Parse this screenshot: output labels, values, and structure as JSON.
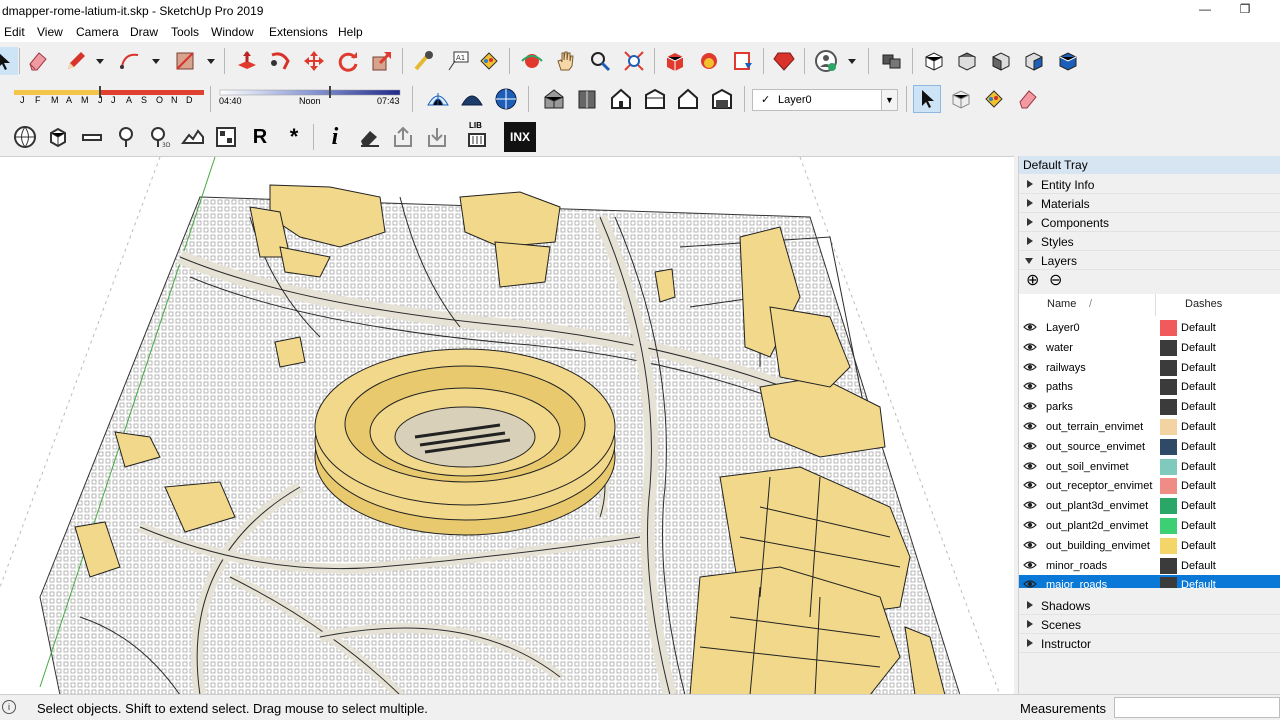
{
  "window": {
    "title": "dmapper-rome-latium-it.skp - SketchUp Pro 2019",
    "minimize_glyph": "—",
    "restore_glyph": "❐"
  },
  "menu": [
    "Edit",
    "View",
    "Camera",
    "Draw",
    "Tools",
    "Window",
    "Extensions",
    "Help"
  ],
  "shadow_settings": {
    "months": [
      "J",
      "F",
      "M",
      "A",
      "M",
      "J",
      "J",
      "A",
      "S",
      "O",
      "N",
      "D"
    ],
    "time_start": "04:40",
    "time_noon": "Noon",
    "time_end": "07:43"
  },
  "layer_selector": {
    "current": "Layer0",
    "check": "✓"
  },
  "toolbar3": {
    "r_label": "R",
    "asterisk_label": "*",
    "info_label": "i",
    "lib_label": "LIB",
    "inx_label": "INX"
  },
  "tray": {
    "title": "Default Tray",
    "panels_top": [
      "Entity Info",
      "Materials",
      "Components",
      "Styles"
    ],
    "layers_panel": "Layers",
    "add_glyph": "⊕",
    "remove_glyph": "⊖",
    "columns": {
      "name": "Name",
      "sort": "/",
      "dashes": "Dashes"
    },
    "layers": [
      {
        "name": "Layer0",
        "color": "#f05a5a",
        "dashes": "Default"
      },
      {
        "name": "water",
        "color": "#3b3b3b",
        "dashes": "Default"
      },
      {
        "name": "railways",
        "color": "#3b3b3b",
        "dashes": "Default"
      },
      {
        "name": "paths",
        "color": "#3b3b3b",
        "dashes": "Default"
      },
      {
        "name": "parks",
        "color": "#3b3b3b",
        "dashes": "Default"
      },
      {
        "name": "out_terrain_envimet",
        "color": "#f4d3a2",
        "dashes": "Default"
      },
      {
        "name": "out_source_envimet",
        "color": "#2f4a66",
        "dashes": "Default"
      },
      {
        "name": "out_soil_envimet",
        "color": "#7fcabd",
        "dashes": "Default"
      },
      {
        "name": "out_receptor_envimet",
        "color": "#f08c86",
        "dashes": "Default"
      },
      {
        "name": "out_plant3d_envimet",
        "color": "#2aa666",
        "dashes": "Default"
      },
      {
        "name": "out_plant2d_envimet",
        "color": "#3ccf73",
        "dashes": "Default"
      },
      {
        "name": "out_building_envimet",
        "color": "#f3d56a",
        "dashes": "Default"
      },
      {
        "name": "minor_roads",
        "color": "#3b3b3b",
        "dashes": "Default"
      },
      {
        "name": "major_roads",
        "color": "#3b3b3b",
        "dashes": "Default"
      }
    ],
    "panels_bottom": [
      "Shadows",
      "Scenes",
      "Instructor"
    ]
  },
  "status": {
    "message": "Select objects. Shift to extend select. Drag mouse to select multiple.",
    "info_glyph": "i",
    "measurements_label": "Measurements",
    "measurements_value": ""
  },
  "colors": {
    "building": "#f1d88b",
    "road": "#e6e3d6",
    "selection": "#0a78d7",
    "tray_header": "#d7e4f2"
  }
}
